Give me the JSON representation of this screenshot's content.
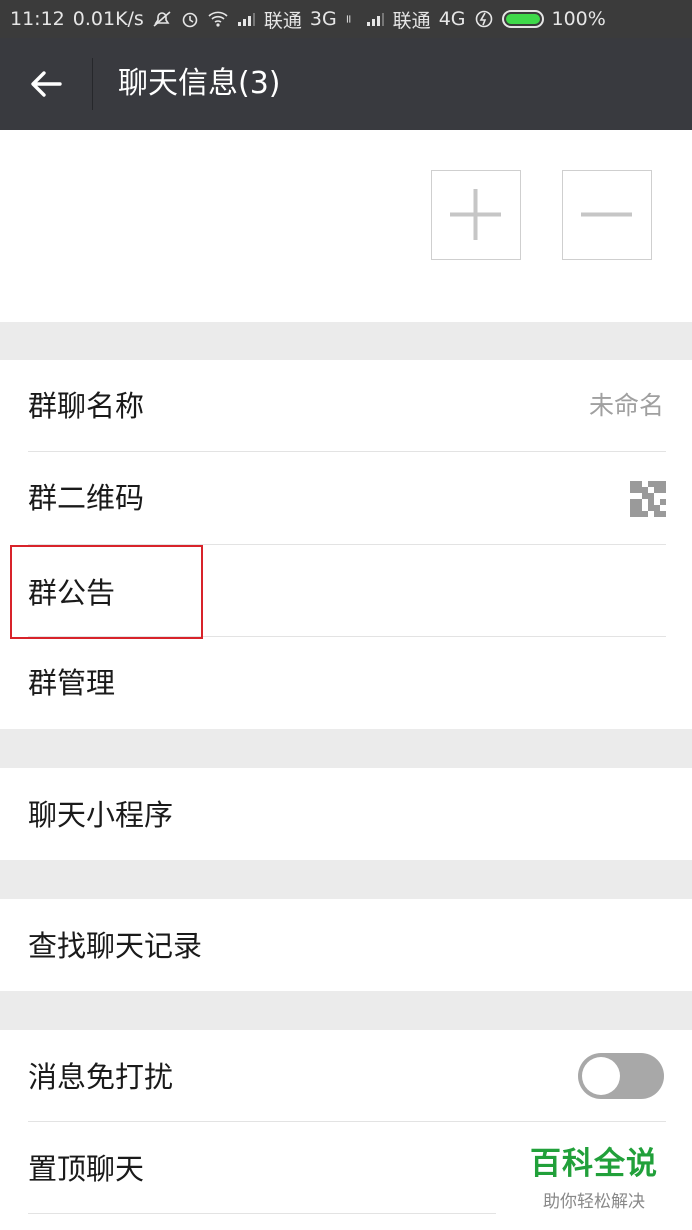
{
  "status_bar": {
    "time": "11:12",
    "speed": "0.01K/s",
    "carrier1": "联通",
    "net1": "3G",
    "carrier2": "联通",
    "net2": "4G",
    "battery": "100%"
  },
  "header": {
    "title": "聊天信息(3)"
  },
  "members": {
    "add_symbol": "+",
    "remove_symbol": "−"
  },
  "settings": {
    "group_name": {
      "label": "群聊名称",
      "value": "未命名"
    },
    "qr_code": {
      "label": "群二维码"
    },
    "announcement": {
      "label": "群公告"
    },
    "management": {
      "label": "群管理"
    },
    "mini_programs": {
      "label": "聊天小程序"
    },
    "search_history": {
      "label": "查找聊天记录"
    },
    "mute": {
      "label": "消息免打扰",
      "enabled": false
    },
    "pin": {
      "label": "置顶聊天"
    }
  },
  "watermark": {
    "title": "百科全说",
    "subtitle": "助你轻松解决"
  },
  "colors": {
    "header_bg": "#393a3f",
    "highlight": "#d8232a",
    "watermark_green": "#21a03a"
  }
}
